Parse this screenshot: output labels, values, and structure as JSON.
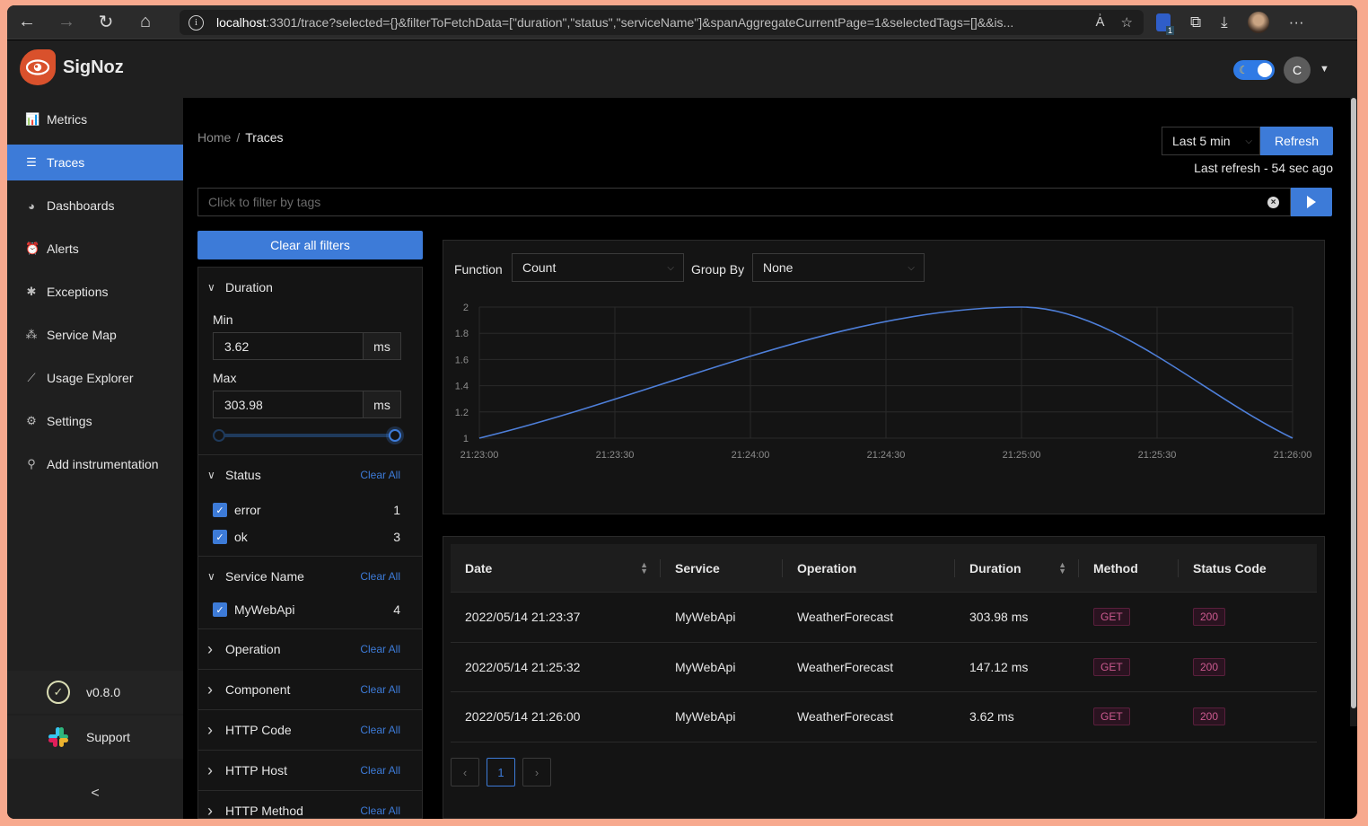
{
  "browser": {
    "url_host": "localhost",
    "url_rest": ":3301/trace?selected={}&filterToFetchData=[\"duration\",\"status\",\"serviceName\"]&spanAggregateCurrentPage=1&selectedTags=[]&&is...",
    "extension_badge": "1"
  },
  "app": {
    "name": "SigNoz",
    "user_initial": "C"
  },
  "sidebar": {
    "items": [
      {
        "label": "Metrics",
        "icon": "bar-chart-icon",
        "glyph": "📊",
        "active": false
      },
      {
        "label": "Traces",
        "icon": "align-left-icon",
        "glyph": "☰",
        "active": true
      },
      {
        "label": "Dashboards",
        "icon": "dashboard-icon",
        "glyph": "◕",
        "active": false
      },
      {
        "label": "Alerts",
        "icon": "alert-icon",
        "glyph": "⏰",
        "active": false
      },
      {
        "label": "Exceptions",
        "icon": "bug-icon",
        "glyph": "✱",
        "active": false
      },
      {
        "label": "Service Map",
        "icon": "deployment-unit-icon",
        "glyph": "⁂",
        "active": false
      },
      {
        "label": "Usage Explorer",
        "icon": "line-chart-icon",
        "glyph": "⟋",
        "active": false
      },
      {
        "label": "Settings",
        "icon": "settings-icon",
        "glyph": "⚙",
        "active": false
      },
      {
        "label": "Add instrumentation",
        "icon": "api-icon",
        "glyph": "⚲",
        "active": false
      }
    ],
    "version": "v0.8.0",
    "support": "Support",
    "collapse": "<"
  },
  "header": {
    "breadcrumb": {
      "home": "Home",
      "separator": "/",
      "current": "Traces"
    },
    "time_range": "Last 5 min",
    "refresh_label": "Refresh",
    "last_refresh": "Last refresh - 54 sec ago",
    "tag_filter_placeholder": "Click to filter by tags",
    "tag_filter_value": ""
  },
  "filters": {
    "clear_all_label": "Clear all filters",
    "clear_label": "Clear All",
    "duration": {
      "title": "Duration",
      "min_label": "Min",
      "min_value": "3.62",
      "max_label": "Max",
      "max_value": "303.98",
      "unit": "ms",
      "slider_range_fraction": [
        0,
        1
      ]
    },
    "status": {
      "title": "Status",
      "options": [
        {
          "label": "error",
          "count": "1",
          "checked": true
        },
        {
          "label": "ok",
          "count": "3",
          "checked": true
        }
      ]
    },
    "service_name": {
      "title": "Service Name",
      "options": [
        {
          "label": "MyWebApi",
          "count": "4",
          "checked": true
        }
      ]
    },
    "collapsed": [
      "Operation",
      "Component",
      "HTTP Code",
      "HTTP Host",
      "HTTP Method"
    ]
  },
  "chart_controls": {
    "function_label": "Function",
    "function_value": "Count",
    "group_by_label": "Group By",
    "group_by_value": "None"
  },
  "chart_data": {
    "type": "line",
    "title": "",
    "xlabel": "",
    "ylabel": "",
    "x": [
      "21:23:00",
      "21:25:00",
      "21:26:00"
    ],
    "x_seconds": [
      0,
      120,
      180
    ],
    "series": [
      {
        "name": "Count",
        "values": [
          1,
          2,
          1
        ],
        "color": "#4e7fd9"
      }
    ],
    "x_ticks": [
      "21:23:00",
      "21:23:30",
      "21:24:00",
      "21:24:30",
      "21:25:00",
      "21:25:30",
      "21:26:00"
    ],
    "y_ticks": [
      "1",
      "1.2",
      "1.4",
      "1.6",
      "1.8",
      "2"
    ],
    "ylim": [
      1,
      2
    ],
    "xlim_seconds": [
      0,
      180
    ],
    "grid": true,
    "legend": "none"
  },
  "table": {
    "columns": [
      {
        "label": "Date",
        "sortable": true
      },
      {
        "label": "Service",
        "sortable": false
      },
      {
        "label": "Operation",
        "sortable": false
      },
      {
        "label": "Duration",
        "sortable": true
      },
      {
        "label": "Method",
        "sortable": false
      },
      {
        "label": "Status Code",
        "sortable": false
      }
    ],
    "rows": [
      {
        "date": "2022/05/14 21:23:37",
        "service": "MyWebApi",
        "operation": "WeatherForecast",
        "duration": "303.98 ms",
        "method": "GET",
        "status_code": "200"
      },
      {
        "date": "2022/05/14 21:25:32",
        "service": "MyWebApi",
        "operation": "WeatherForecast",
        "duration": "147.12 ms",
        "method": "GET",
        "status_code": "200"
      },
      {
        "date": "2022/05/14 21:26:00",
        "service": "MyWebApi",
        "operation": "WeatherForecast",
        "duration": "3.62 ms",
        "method": "GET",
        "status_code": "200"
      }
    ],
    "pagination": {
      "prev": "‹",
      "current_page": "1",
      "next": "›"
    }
  }
}
